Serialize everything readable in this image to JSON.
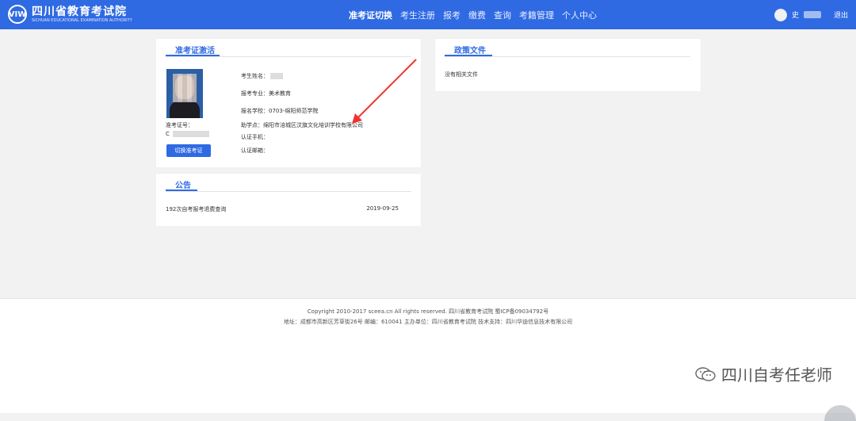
{
  "header": {
    "logo_text": "四川省教育考试院",
    "logo_sub": "SICHUAN EDUCATIONAL EXAMINATION AUTHORITY",
    "logo_mark": "VIW",
    "nav": [
      {
        "label": "准考证切换",
        "active": true
      },
      {
        "label": "考生注册",
        "active": false
      },
      {
        "label": "报考",
        "active": false
      },
      {
        "label": "缴费",
        "active": false
      },
      {
        "label": "查询",
        "active": false
      },
      {
        "label": "考籍管理",
        "active": false
      },
      {
        "label": "个人中心",
        "active": false
      }
    ],
    "user_initial": "史",
    "logout": "退出"
  },
  "admission_card": {
    "title": "准考证激活",
    "fields": {
      "name_label": "考生姓名：",
      "major": "报考专业：美术教育",
      "school": "报名学校：0703-绵阳师范学院",
      "assist_point": "助学点：绵阳市涪城区汶旗文化培训学校有限公司",
      "phone_label": "认证手机：",
      "email_label": "认证邮箱："
    },
    "ticket_label": "准考证号：",
    "ticket_number_prefix": "C",
    "switch_button": "切换准考证"
  },
  "policy": {
    "title": "政策文件",
    "empty_text": "没有相关文件"
  },
  "announcement": {
    "title": "公告",
    "items": [
      {
        "text": "192次自考报考退费查询",
        "date": "2019-09-25"
      }
    ]
  },
  "footer": {
    "copyright": "Copyright 2010-2017 sceea.cn All rights reserved. 四川省教育考试院 蜀ICP备09034792号",
    "address": "地址：成都市高新区芳草街26号 邮编：610041 主办单位：四川省教育考试院 技术支持：四川华迪信息技术有限公司"
  },
  "watermark": "四川自考任老师"
}
